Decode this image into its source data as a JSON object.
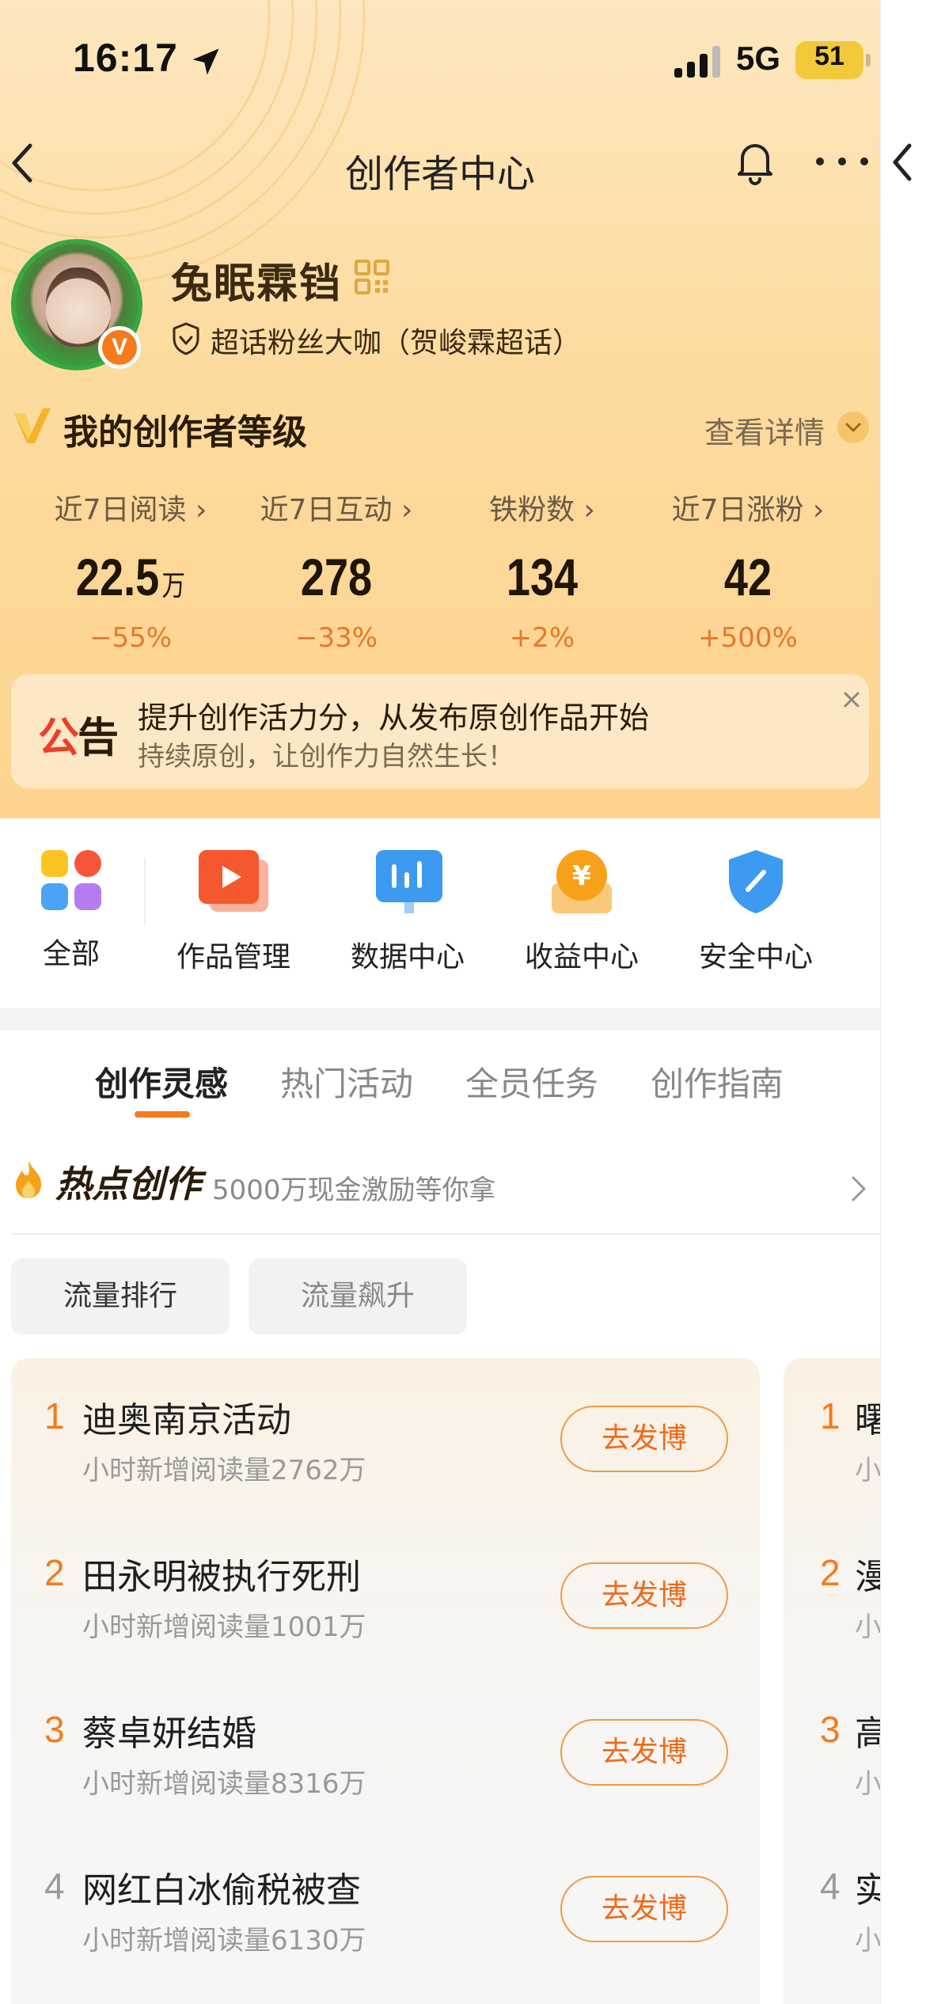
{
  "status_bar": {
    "time": "16:17",
    "network": "5G",
    "battery": "51"
  },
  "nav": {
    "title": "创作者中心"
  },
  "profile": {
    "username": "兔眠霖铛",
    "tag": "超话粉丝大咖（贺峻霖超话）",
    "badge": "V"
  },
  "level": {
    "title": "我的创作者等级",
    "detail": "查看详情"
  },
  "stats": [
    {
      "label": "近7日阅读 ›",
      "value": "22.5",
      "unit": "万",
      "change": "−55%"
    },
    {
      "label": "近7日互动 ›",
      "value": "278",
      "unit": "",
      "change": "−33%"
    },
    {
      "label": "铁粉数 ›",
      "value": "134",
      "unit": "",
      "change": "+2%"
    },
    {
      "label": "近7日涨粉 ›",
      "value": "42",
      "unit": "",
      "change": "+500%"
    }
  ],
  "notice": {
    "tag_part1": "公",
    "tag_part2": "告",
    "title": "提升创作活力分，从发布原创作品开始",
    "subtitle": "持续原创，让创作力自然生长！"
  },
  "shortcuts": [
    {
      "label": "全部",
      "icon": "grid-icon"
    },
    {
      "label": "作品管理",
      "icon": "play-icon"
    },
    {
      "label": "数据中心",
      "icon": "chart-icon"
    },
    {
      "label": "收益中心",
      "icon": "yuan-icon"
    },
    {
      "label": "安全中心",
      "icon": "shield-icon"
    }
  ],
  "tabs": [
    "创作灵感",
    "热门活动",
    "全员任务",
    "创作指南"
  ],
  "hot": {
    "title": "热点创作",
    "subtitle": "5000万现金激励等你拿"
  },
  "chips": [
    "流量排行",
    "流量飙升"
  ],
  "trending": [
    {
      "rank": "1",
      "title": "迪奥南京活动",
      "meta": "小时新增阅读量2762万",
      "button": "去发博"
    },
    {
      "rank": "2",
      "title": "田永明被执行死刑",
      "meta": "小时新增阅读量1001万",
      "button": "去发博"
    },
    {
      "rank": "3",
      "title": "蔡卓妍结婚",
      "meta": "小时新增阅读量8316万",
      "button": "去发博"
    },
    {
      "rank": "4",
      "title": "网红白冰偷税被查",
      "meta": "小时新增阅读量6130万",
      "button": "去发博"
    }
  ],
  "trending_peek": [
    {
      "rank": "1",
      "title": "曙",
      "meta": "小"
    },
    {
      "rank": "2",
      "title": "漫",
      "meta": "小"
    },
    {
      "rank": "3",
      "title": "高",
      "meta": "小"
    },
    {
      "rank": "4",
      "title": "实",
      "meta": "小"
    }
  ],
  "colors": {
    "accent": "#f47a1c",
    "notice_red": "#e8402a",
    "hero_bg": "#fddb9f"
  }
}
